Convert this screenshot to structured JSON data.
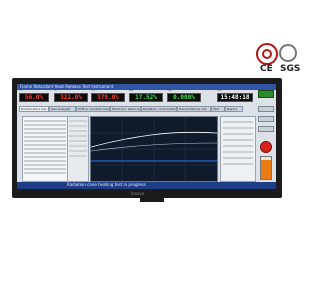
{
  "logos": {
    "brand_name": "logo",
    "certs": [
      "CE",
      "SGS"
    ]
  },
  "monitor": {
    "bezel_brand": "lenovo"
  },
  "app": {
    "title": "Flame Retardant Heat Release Test Instrument",
    "readouts": [
      {
        "caption": "O2",
        "value": "56.0%",
        "color": "#ff3b30"
      },
      {
        "caption": "CO",
        "value": "321.0%",
        "color": "#ff3b30"
      },
      {
        "caption": "CO2",
        "value": "379.0%",
        "color": "#ff3b30"
      },
      {
        "caption": "HRR",
        "value": "17.52%",
        "color": "#39e05a"
      },
      {
        "caption": "THR",
        "value": "0.000%",
        "color": "#39e05a"
      },
      {
        "caption": "Time",
        "value": "15:48:18",
        "color": "#ffffff"
      }
    ],
    "tabs": [
      {
        "label": "Radiometers CAL"
      },
      {
        "label": "Gas analyzer"
      },
      {
        "label": "Orifice constant CAL"
      },
      {
        "label": "Electronic balance"
      },
      {
        "label": "Radiation cone heating"
      },
      {
        "label": "Transmittance CAL"
      },
      {
        "label": "Test"
      },
      {
        "label": "Report"
      }
    ],
    "status_text": "Radiation cone heating test in progress",
    "colors": {
      "accent": "#2f55a4",
      "stop": "#d9221c",
      "level": "#e97a14"
    },
    "level_fraction": 0.85
  }
}
